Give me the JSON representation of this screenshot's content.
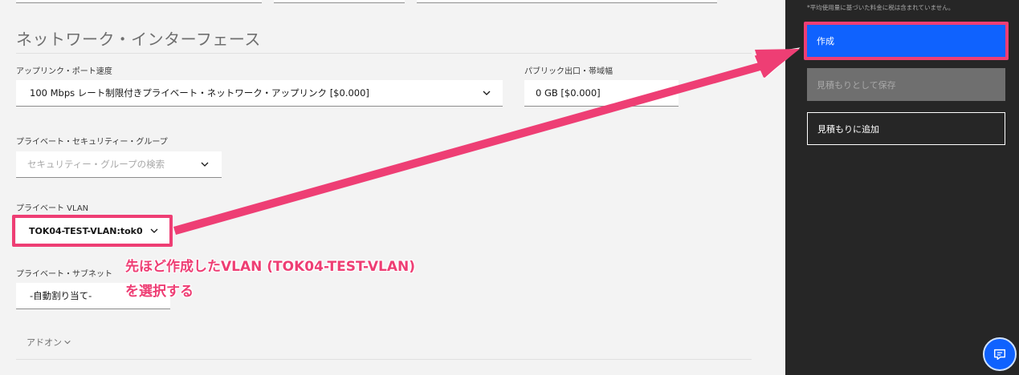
{
  "page": {
    "section_title": "ネットワーク・インターフェース"
  },
  "uplink": {
    "label": "アップリンク・ポート速度",
    "value": "100 Mbps レート制限付きプライベート・ネットワーク・アップリンク [$0.000]"
  },
  "bandwidth": {
    "label": "パブリック出口・帯域幅",
    "value": "0 GB [$0.000]"
  },
  "security_group": {
    "label": "プライベート・セキュリティー・グループ",
    "placeholder": "セキュリティー・グループの検索"
  },
  "private_vlan": {
    "label": "プライベート VLAN",
    "value": "TOK04-TEST-VLAN:tok0"
  },
  "private_subnet": {
    "label": "プライベート・サブネット",
    "value": "-自動割り当て-"
  },
  "addon": {
    "label": "アドオン"
  },
  "annotation": {
    "line1": "先ほど作成したVLAN (TOK04-TEST-VLAN)",
    "line2": "を選択する"
  },
  "sidebar": {
    "note": "*平均使用量に基づいた料金に税は含まれていません。",
    "create_label": "作成",
    "save_estimate_label": "見積もりとして保存",
    "add_estimate_label": "見積もりに追加"
  },
  "colors": {
    "accent": "#0f62fe",
    "highlight": "#ee3e74",
    "sidebar_bg": "#262626",
    "main_bg": "#f3f3f3"
  },
  "icons": {
    "select": "chevron-down-icon",
    "chat": "chat-icon"
  }
}
